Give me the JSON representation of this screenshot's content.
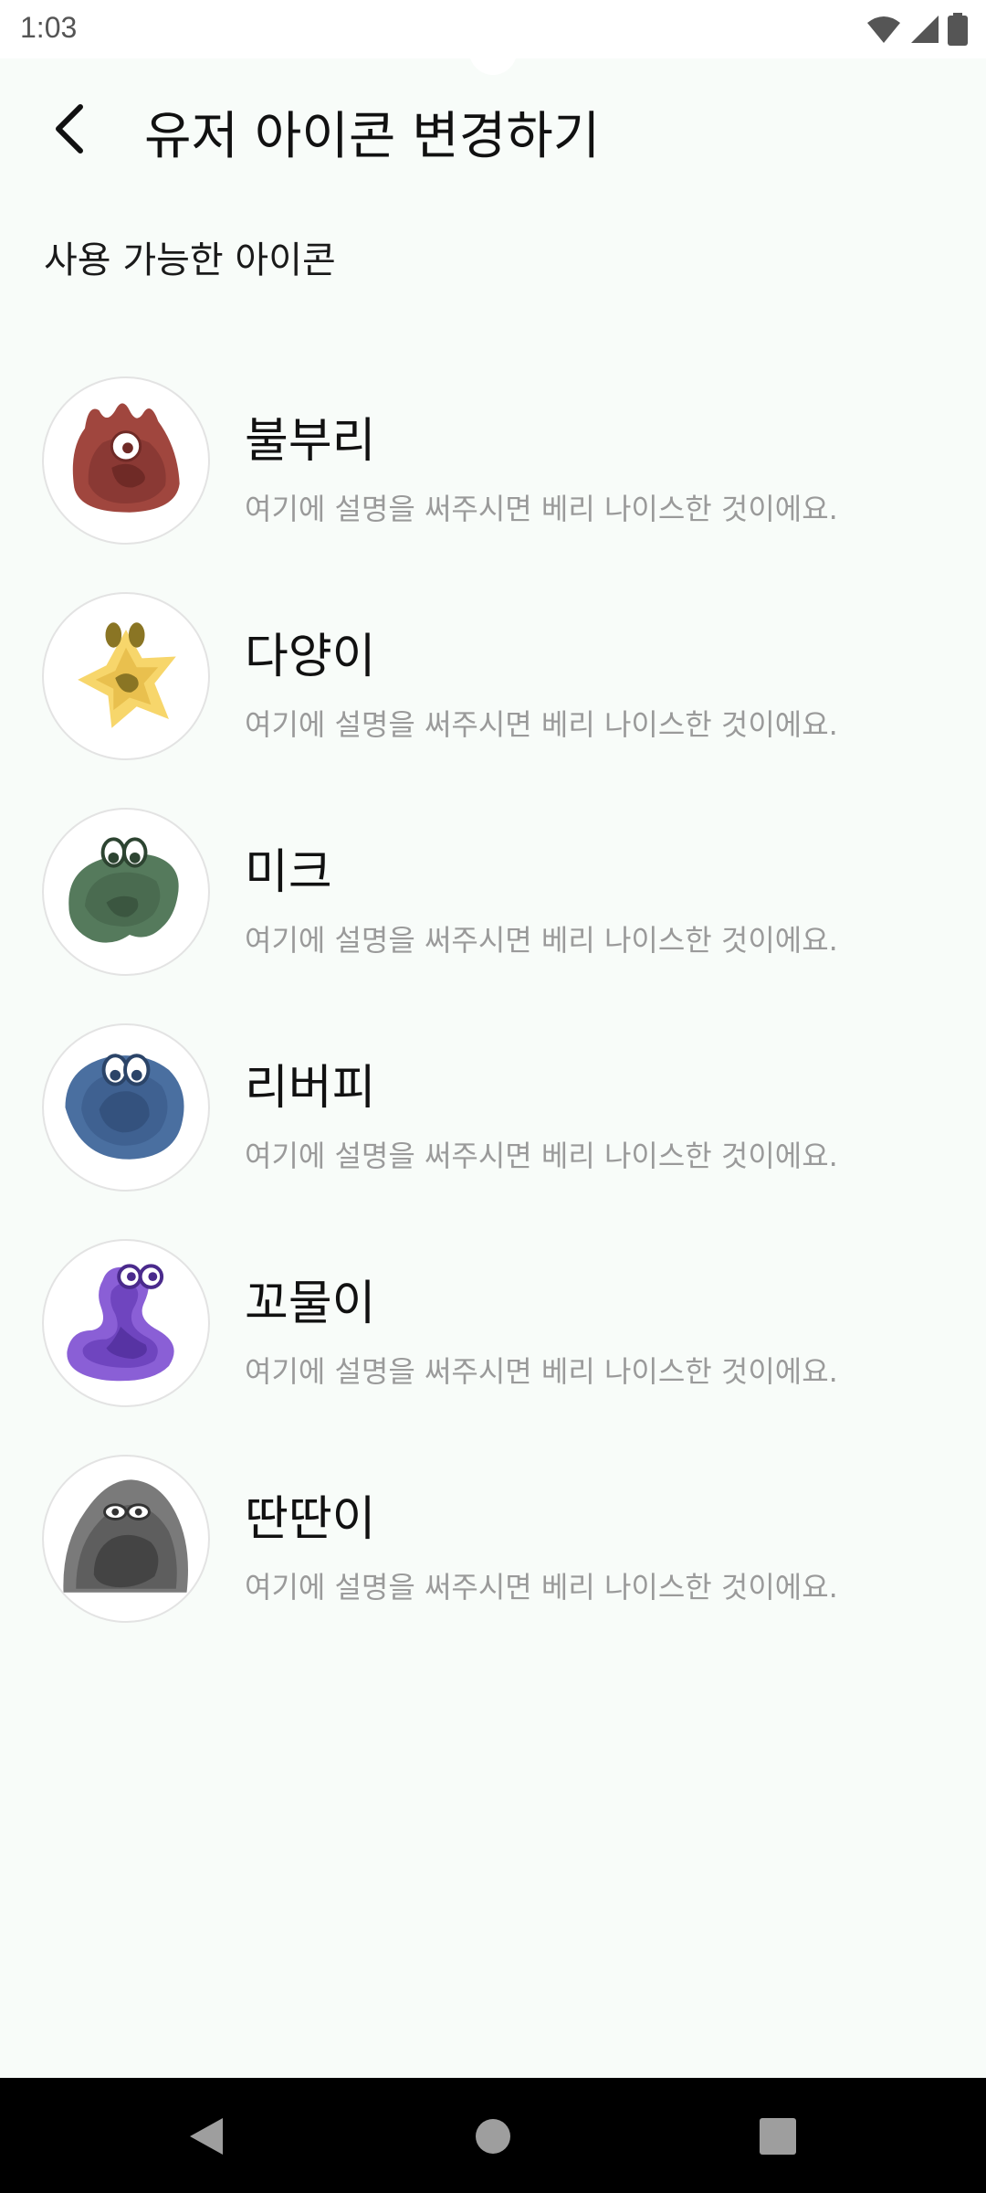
{
  "status": {
    "time": "1:03",
    "icons": [
      "wifi-icon",
      "signal-icon",
      "battery-icon"
    ]
  },
  "header": {
    "back_icon": "chevron-left-icon",
    "title": "유저 아이콘 변경하기"
  },
  "section": {
    "label": "사용 가능한 아이콘"
  },
  "items": [
    {
      "name": "불부리",
      "description": "여기에 설명을 써주시면 베리 나이스한 것이에요.",
      "color": "#a0463e"
    },
    {
      "name": "다양이",
      "description": "여기에 설명을 써주시면 베리 나이스한 것이에요.",
      "color": "#f7d66b"
    },
    {
      "name": "미크",
      "description": "여기에 설명을 써주시면 베리 나이스한 것이에요.",
      "color": "#557a5c"
    },
    {
      "name": "리버피",
      "description": "여기에 설명을 써주시면 베리 나이스한 것이에요.",
      "color": "#4a6fa0"
    },
    {
      "name": "꼬물이",
      "description": "여기에 설명을 써주시면 베리 나이스한 것이에요.",
      "color": "#8a5fd6"
    },
    {
      "name": "딴딴이",
      "description": "여기에 설명을 써주시면 베리 나이스한 것이에요.",
      "color": "#6d6d6d"
    }
  ],
  "navbar": {
    "icons": [
      "back-triangle-icon",
      "home-circle-icon",
      "recents-square-icon"
    ]
  }
}
